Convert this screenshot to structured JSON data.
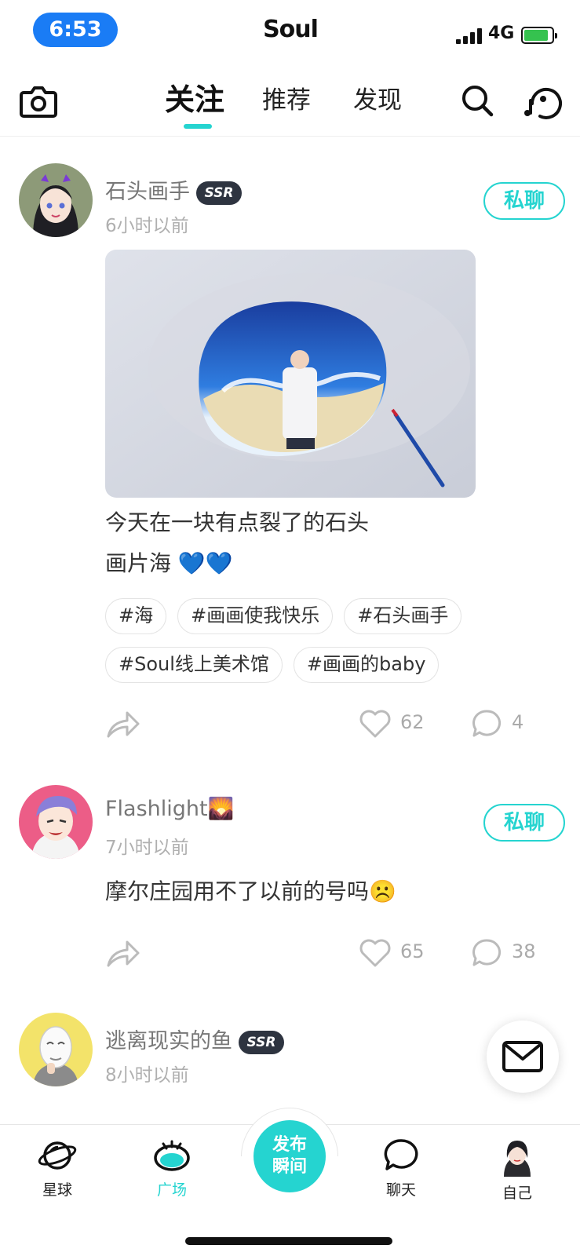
{
  "status_bar": {
    "time": "6:53",
    "app_name": "Soul",
    "network": "4G"
  },
  "top_nav": {
    "tabs": [
      {
        "label": "关注",
        "active": true
      },
      {
        "label": "推荐",
        "active": false
      },
      {
        "label": "发现",
        "active": false
      }
    ],
    "icons": [
      "camera-icon",
      "search-icon",
      "music-note-icon"
    ]
  },
  "posts": [
    {
      "username": "石头画手",
      "badge": "SSR",
      "time": "6小时以前",
      "chat_label": "私聊",
      "text_line1": "今天在一块有点裂了的石头",
      "text_line2": "画片海 💙💙",
      "tags": [
        "#海",
        "#画画使我快乐",
        "#石头画手",
        "#Soul线上美术馆",
        "#画画的baby"
      ],
      "likes": "62",
      "comments": "4"
    },
    {
      "username": "Flashlight🌄",
      "time": "7小时以前",
      "chat_label": "私聊",
      "text_line1": "摩尔庄园用不了以前的号吗☹️",
      "likes": "65",
      "comments": "38"
    },
    {
      "username": "逃离现实的鱼",
      "badge": "SSR",
      "time": "8小时以前"
    }
  ],
  "bottom_nav": {
    "items": [
      {
        "label": "星球",
        "icon": "planet-icon",
        "active": false
      },
      {
        "label": "广场",
        "icon": "square-eye-icon",
        "active": true
      },
      {
        "label": "聊天",
        "icon": "chat-bubble-icon",
        "active": false
      },
      {
        "label": "自己",
        "icon": "self-avatar-icon",
        "active": false
      }
    ],
    "publish_line1": "发布",
    "publish_line2": "瞬间"
  },
  "colors": {
    "accent": "#25d4d0",
    "time_pill": "#1a7cf5",
    "badge_bg": "#2e3440"
  }
}
